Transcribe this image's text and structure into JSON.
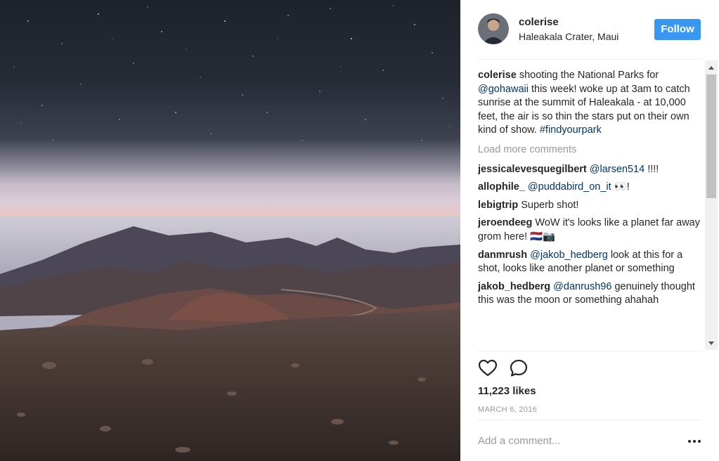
{
  "post": {
    "username": "colerise",
    "location": "Haleakala Crater, Maui",
    "follow_label": "Follow",
    "caption": {
      "user": "colerise",
      "text_before": " shooting the National Parks for ",
      "mention": "@gohawaii",
      "text_after": " this week! woke up at 3am to catch sunrise at the summit of Haleakala - at 10,000 feet, the air is so thin the stars put on their own kind of show. ",
      "hashtag": "#findyourpark"
    },
    "load_more_label": "Load more comments",
    "comments": [
      {
        "user": "jessicalevesquegilbert",
        "mention": "@larsen514",
        "text": " !!!!"
      },
      {
        "user": "allophile_",
        "mention": "@puddabird_on_it",
        "text": " 👀!"
      },
      {
        "user": "lebigtrip",
        "mention": "",
        "text": "Superb shot!"
      },
      {
        "user": "jeroendeeg",
        "mention": "",
        "text": "WoW it's looks like a planet far away grom here! 🇳🇱📷"
      },
      {
        "user": "danmrush",
        "mention": "@jakob_hedberg",
        "text": " look at this for a shot, looks like another planet or something"
      },
      {
        "user": "jakob_hedberg",
        "mention": "@danrush96",
        "text": " genuinely thought this was the moon or something ahahah"
      }
    ],
    "likes": "11,223 likes",
    "date": "MARCH 6, 2016",
    "add_comment_placeholder": "Add a comment...",
    "icons": {
      "like": "heart-icon",
      "comment": "comment-bubble-icon",
      "more": "more-options-icon"
    }
  }
}
